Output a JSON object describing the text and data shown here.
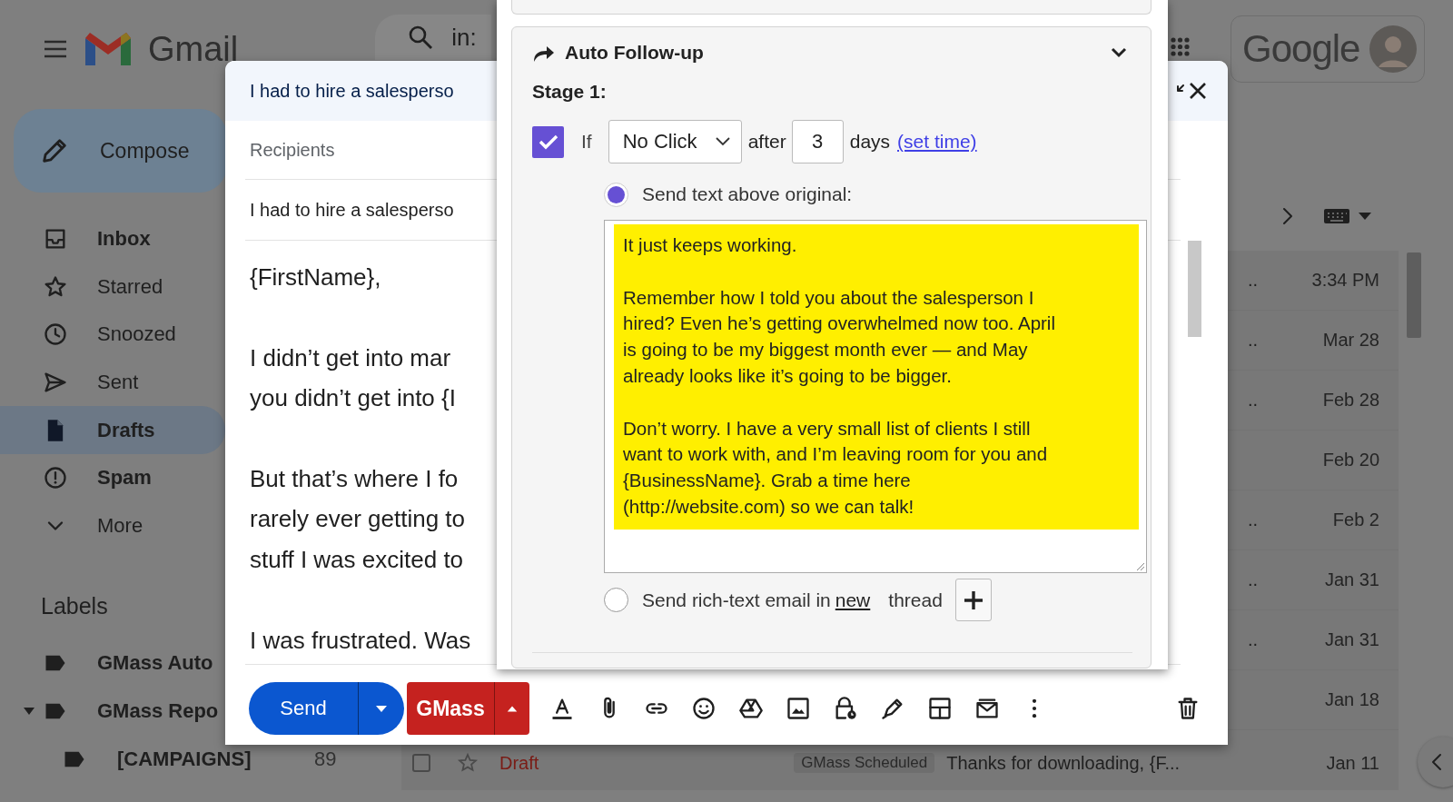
{
  "gmail_header": {
    "app_name": "Gmail",
    "search_text": "in:"
  },
  "account": {
    "logo_text": "Google"
  },
  "sidebar": {
    "compose_label": "Compose",
    "items": [
      {
        "kind": "inbox",
        "label": "Inbox",
        "unread": true,
        "selected": false
      },
      {
        "kind": "starred",
        "label": "Starred",
        "unread": false,
        "selected": false
      },
      {
        "kind": "snoozed",
        "label": "Snoozed",
        "unread": false,
        "selected": false
      },
      {
        "kind": "sent",
        "label": "Sent",
        "unread": false,
        "selected": false
      },
      {
        "kind": "drafts",
        "label": "Drafts",
        "unread": true,
        "selected": true
      },
      {
        "kind": "spam",
        "label": "Spam",
        "unread": true,
        "selected": false
      },
      {
        "kind": "more",
        "label": "More",
        "unread": false,
        "selected": false
      }
    ],
    "labels_heading": "Labels",
    "labels": [
      {
        "name": "GMass Auto"
      },
      {
        "name": "GMass Repo",
        "expanded": true,
        "children": [
          {
            "name": "[CAMPAIGNS]",
            "count": "89"
          }
        ]
      }
    ]
  },
  "mail_list": {
    "rows": [
      {
        "kind": "hidden",
        "selected": false,
        "tail": "..",
        "date": "3:34 PM"
      },
      {
        "kind": "hidden",
        "selected": false,
        "tail": "..",
        "date": "Mar 28"
      },
      {
        "kind": "hidden",
        "selected": false,
        "tail": "..",
        "date": "Feb 28"
      },
      {
        "kind": "hidden",
        "selected": false,
        "date": "Feb 20"
      },
      {
        "kind": "hidden",
        "selected": false,
        "tail": "..",
        "date": "Feb 2"
      },
      {
        "kind": "hidden",
        "selected": false,
        "tail": "..",
        "date": "Jan 31"
      },
      {
        "kind": "hidden",
        "selected": false,
        "tail": "..",
        "date": "Jan 31"
      },
      {
        "kind": "hidden",
        "selected": false,
        "date": "Jan 18"
      },
      {
        "kind": "message",
        "selected": false,
        "starred": false,
        "status": "Draft",
        "tag": "GMass Scheduled",
        "subject": "Thanks for downloading, {F...",
        "date": "Jan 11"
      }
    ]
  },
  "compose": {
    "title": "I had to hire a salesperso",
    "recipients_placeholder": "Recipients",
    "subject": "I had to hire a salesperso",
    "body": [
      [
        "{FirstName},"
      ],
      [
        "I didn’t get into mar",
        "you didn’t get into {I"
      ],
      [
        "But that’s where I fo",
        "rarely ever getting to",
        "stuff I was excited to"
      ],
      [
        "I was frustrated. Was"
      ]
    ],
    "send_label": "Send",
    "gmass_label": "GMass"
  },
  "followup": {
    "title": "Auto Follow-up",
    "expanded": true,
    "stage_label": "Stage 1:",
    "enabled": true,
    "if_label": "If",
    "condition": "No Click",
    "after_label": "after",
    "days_value": "3",
    "days_label": "days",
    "set_time_link": "(set time)",
    "options": [
      {
        "kind": "text",
        "selected": true,
        "label": "Send text above original:"
      },
      {
        "kind": "rich",
        "selected": false,
        "label_before": "Send rich-text email in",
        "link": "new",
        "label_after": "thread"
      }
    ],
    "message": [
      [
        "It just keeps working."
      ],
      [
        "Remember how I told you about the salesperson I",
        "hired? Even he’s getting overwhelmed now too. April",
        "is going to be my biggest month ever — and May",
        "already looks like it’s going to be bigger."
      ],
      [
        "Don’t worry. I have a very small list of clients I still",
        "want to work with, and I’m leaving room for you and",
        "{BusinessName}. Grab a time here",
        "(http://website.com) so we can talk!"
      ]
    ]
  }
}
